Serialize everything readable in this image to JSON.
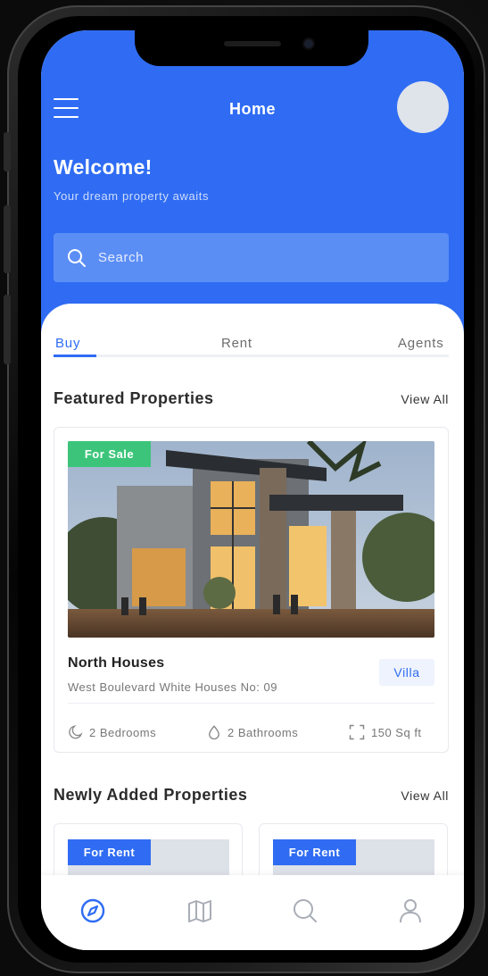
{
  "header": {
    "title": "Home",
    "welcome": "Welcome!",
    "subtitle": "Your dream property awaits"
  },
  "search": {
    "placeholder": "Search"
  },
  "tabs": [
    {
      "label": "Buy",
      "active": true
    },
    {
      "label": "Rent",
      "active": false
    },
    {
      "label": "Agents",
      "active": false
    }
  ],
  "featured": {
    "title": "Featured Properties",
    "view_all": "View All",
    "property": {
      "badge": "For Sale",
      "name": "North Houses",
      "address": "West Boulevard White Houses No: 09",
      "type": "Villa",
      "bedrooms": "2 Bedrooms",
      "bathrooms": "2 Bathrooms",
      "area": "150 Sq ft"
    }
  },
  "newly_added": {
    "title": "Newly Added Properties",
    "view_all": "View All",
    "cards": [
      {
        "badge": "For Rent"
      },
      {
        "badge": "For Rent"
      }
    ]
  },
  "bottom_nav": {
    "items": [
      {
        "icon": "compass-icon",
        "active": true
      },
      {
        "icon": "map-icon",
        "active": false
      },
      {
        "icon": "search-icon",
        "active": false
      },
      {
        "icon": "user-icon",
        "active": false
      }
    ]
  },
  "colors": {
    "primary": "#2f6cf3",
    "sale_badge": "#3cc57a",
    "backdrop_accent": "#5fd0dc"
  }
}
